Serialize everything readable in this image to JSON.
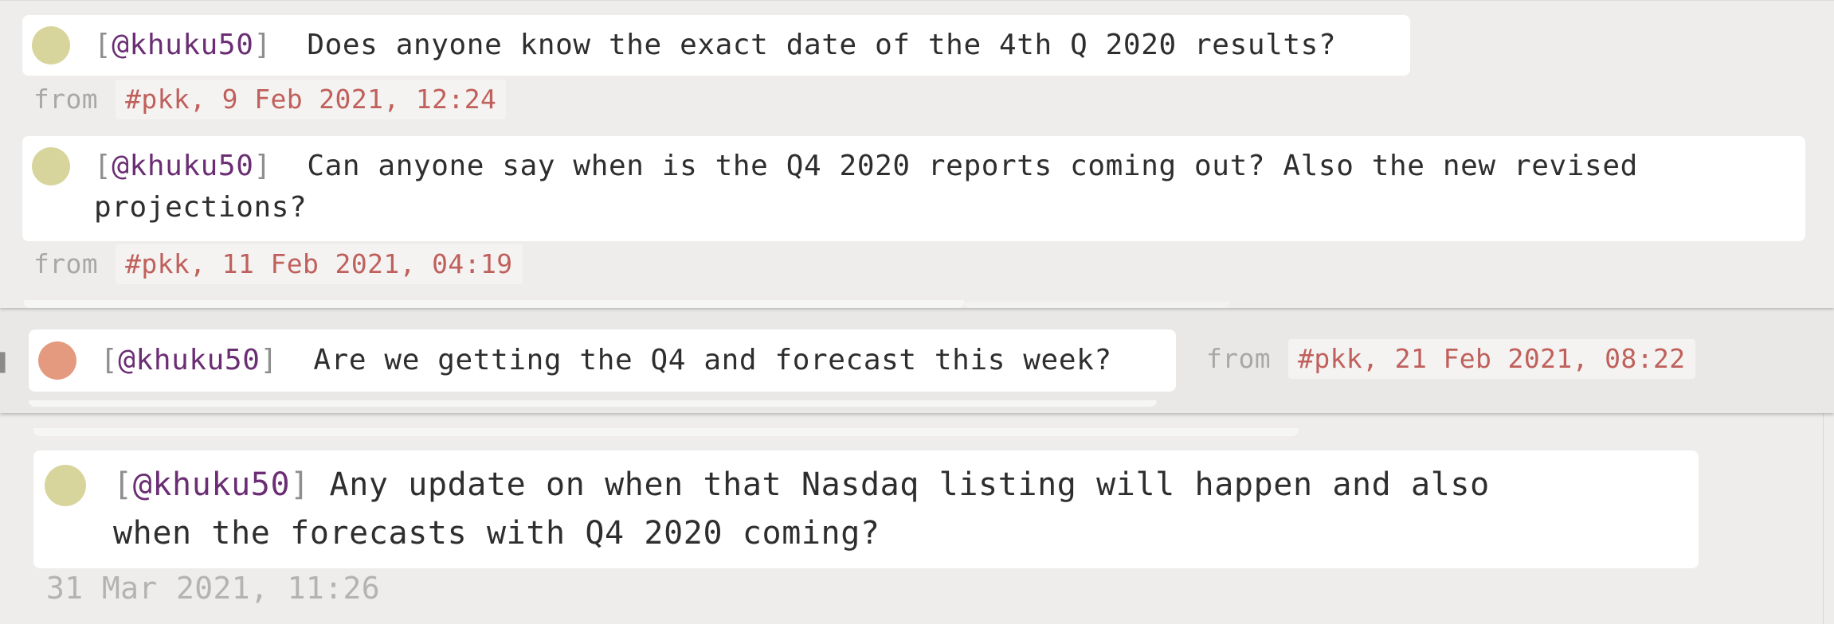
{
  "messages": [
    {
      "username": "@khuku50",
      "bracket_open": "[",
      "bracket_close": "]",
      "text": "Does anyone know the exact date of the 4th Q 2020 results?",
      "from_label": "from",
      "channel_time": "#pkk, 9 Feb 2021, 12:24",
      "avatar_color": "#d8d59c"
    },
    {
      "username": "@khuku50",
      "bracket_open": "[",
      "bracket_close": "]",
      "text_line1": "Can anyone say when is the Q4 2020 reports coming out? Also the new revised",
      "text_line2": "projections?",
      "from_label": "from",
      "channel_time": "#pkk, 11 Feb 2021, 04:19",
      "avatar_color": "#d8d59c"
    },
    {
      "username": "@khuku50",
      "bracket_open": "[",
      "bracket_close": "]",
      "text": "Are we getting the Q4 and forecast this week?",
      "from_label": "from",
      "channel_time": "#pkk, 21 Feb 2021, 08:22",
      "avatar_color": "#e49a7e"
    },
    {
      "username": "@khuku50",
      "bracket_open": "[",
      "bracket_close": "]",
      "text_line1": "Any update on when that Nasdaq listing will happen and also",
      "text_line2": "when the forecasts with Q4 2020 coming?",
      "timestamp": "31 Mar 2021, 11:26",
      "avatar_color": "#d8d59c"
    }
  ],
  "colors": {
    "username": "#6b2e74",
    "channel": "#c0605c",
    "muted": "#a8a8a8"
  }
}
